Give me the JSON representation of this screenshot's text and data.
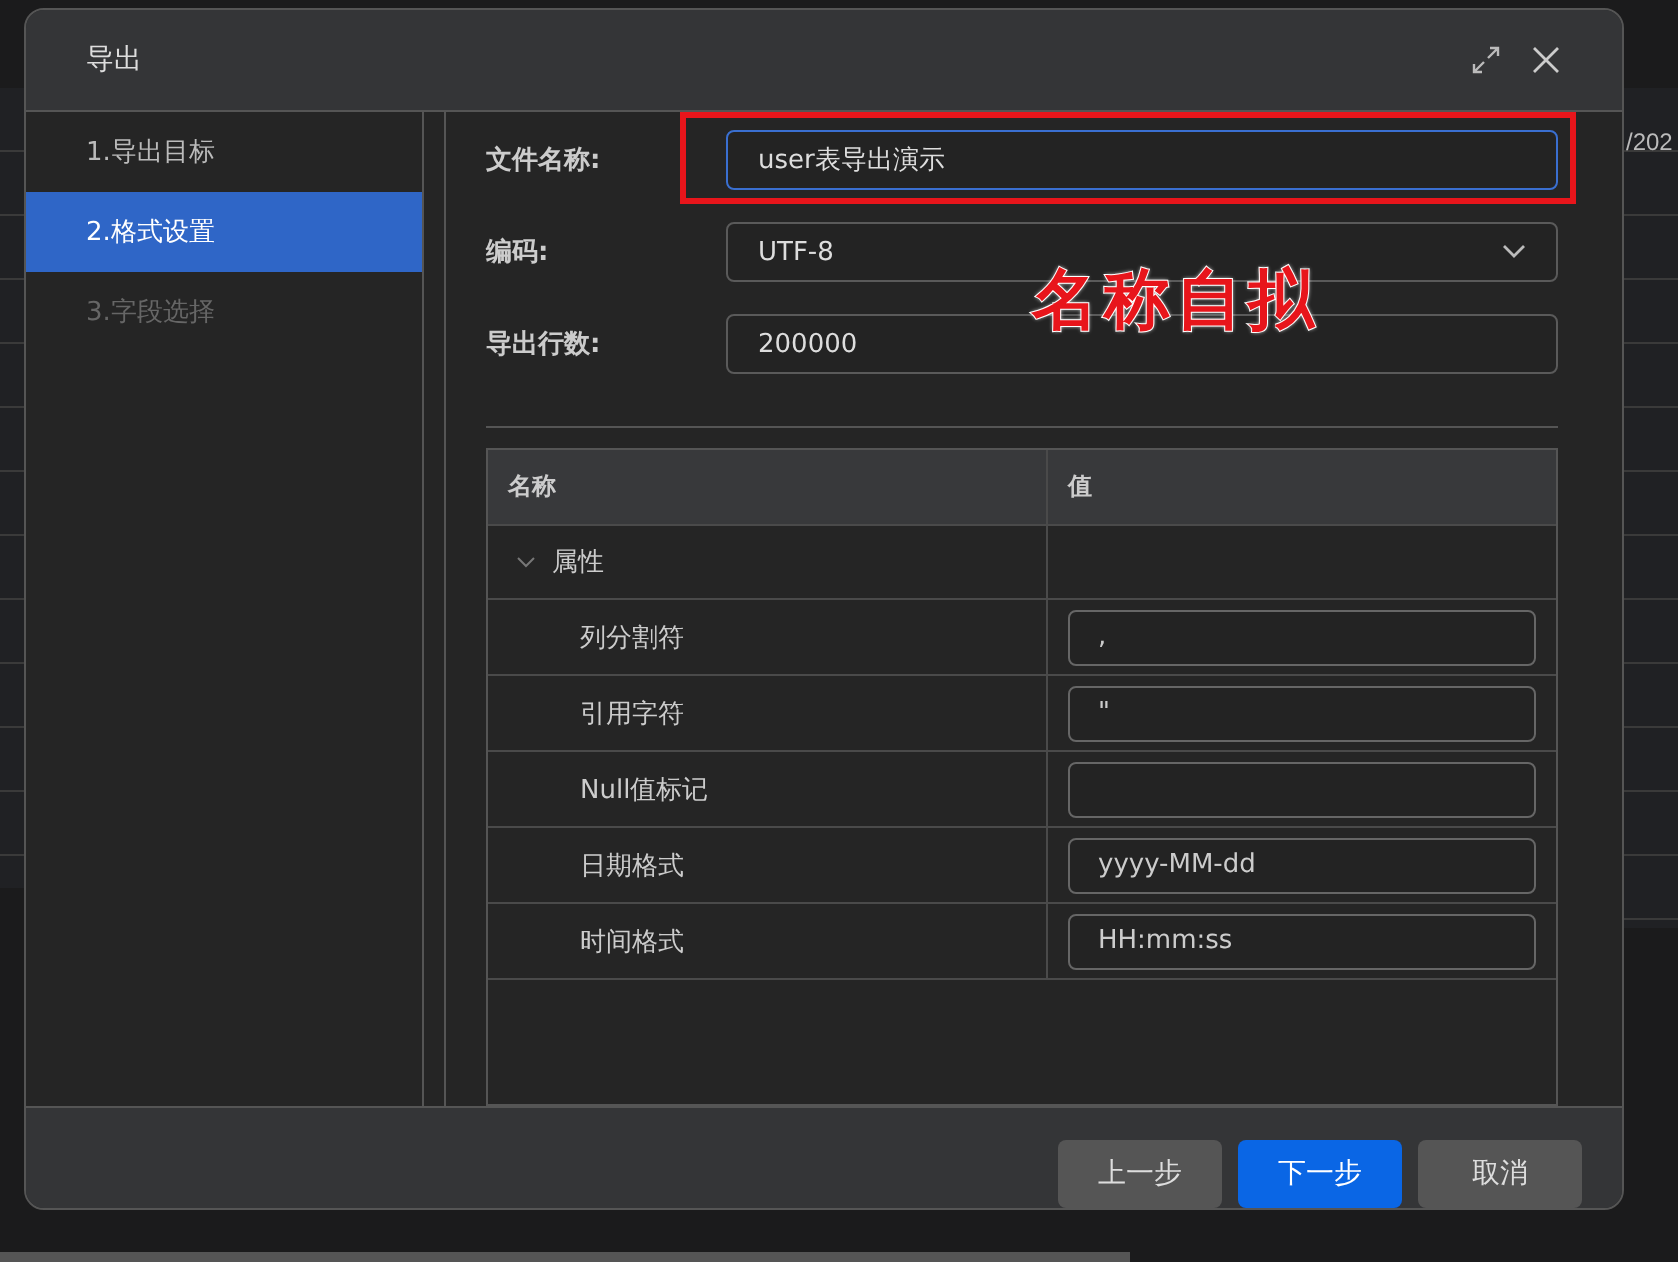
{
  "background": {
    "fragment": "/202"
  },
  "dialog": {
    "title": "导出",
    "steps": [
      {
        "label": "1.导出目标",
        "selected": false,
        "disabled": false
      },
      {
        "label": "2.格式设置",
        "selected": true,
        "disabled": false
      },
      {
        "label": "3.字段选择",
        "selected": false,
        "disabled": true
      }
    ],
    "form": [
      {
        "label": "文件名称:",
        "kind": "text",
        "value": "user表导出演示",
        "focused": true
      },
      {
        "label": "编码:",
        "kind": "select",
        "value": "UTF-8",
        "focused": false
      },
      {
        "label": "导出行数:",
        "kind": "text",
        "value": "200000",
        "focused": false
      }
    ],
    "table": {
      "columns": [
        "名称",
        "值"
      ],
      "groups": [
        {
          "label": "属性",
          "expanded": true,
          "children": [
            {
              "name": "列分割符",
              "value": ","
            },
            {
              "name": "引用字符",
              "value": "\""
            },
            {
              "name": "Null值标记"
            },
            {
              "name": "日期格式",
              "value": "yyyy-MM-dd"
            },
            {
              "name": "时间格式",
              "value": "HH:mm:ss"
            }
          ]
        }
      ]
    },
    "buttons": [
      {
        "label": "上一步",
        "kind": "secondary"
      },
      {
        "label": "下一步",
        "kind": "primary"
      },
      {
        "label": "取消",
        "kind": "secondary"
      }
    ]
  },
  "annotation": {
    "text": "名称自拟"
  }
}
